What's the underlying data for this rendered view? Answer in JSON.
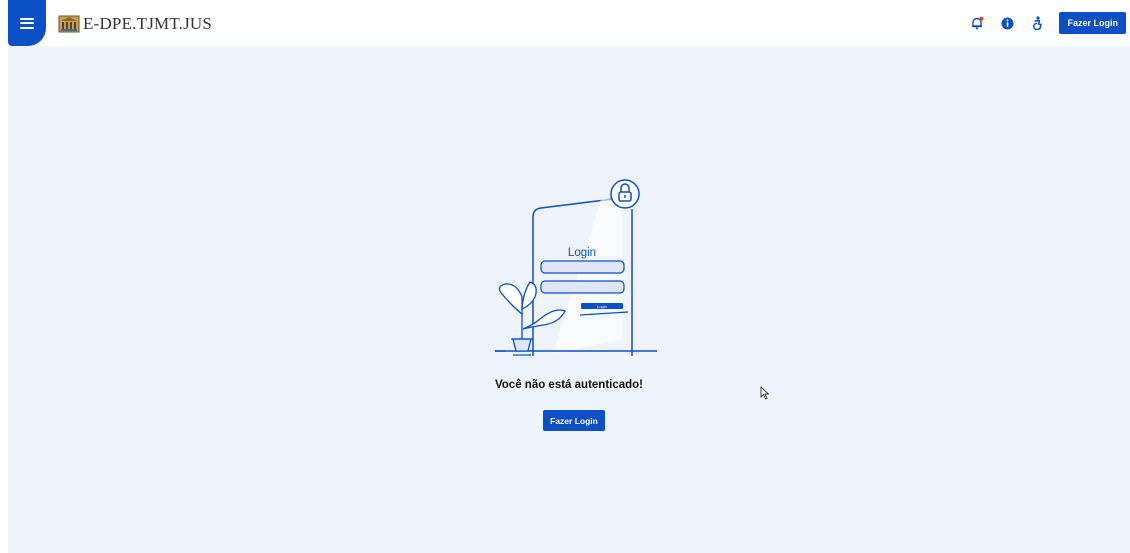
{
  "header": {
    "brand_name": "E-DPE.TJMT.JUS",
    "login_label": "Fazer Login",
    "icons": [
      "menu-icon",
      "bell-icon",
      "info-icon",
      "accessibility-icon"
    ]
  },
  "main": {
    "illustration_title": "Login",
    "illustration_button": "Login",
    "message": "Você não está autenticado!",
    "login_label": "Fazer Login"
  },
  "colors": {
    "primary": "#0b4fc5",
    "background": "#eef3fc",
    "notification_dot": "#e53935"
  }
}
